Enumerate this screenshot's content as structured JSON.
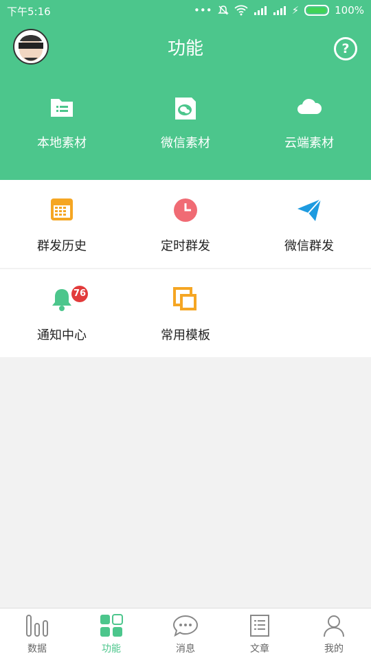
{
  "status_bar": {
    "time": "下午5:16",
    "battery": "100%",
    "icons": [
      "more-icon",
      "mute-bell-icon",
      "wifi-icon",
      "signal-icon",
      "signal-icon",
      "charging-icon",
      "battery-icon"
    ]
  },
  "header": {
    "title": "功能",
    "help_glyph": "?",
    "items": [
      {
        "label": "本地素材",
        "icon": "folder-icon"
      },
      {
        "label": "微信素材",
        "icon": "wechat-doc-icon"
      },
      {
        "label": "云端素材",
        "icon": "cloud-icon"
      }
    ]
  },
  "grid_row1": [
    {
      "label": "群发历史",
      "icon": "calendar-icon"
    },
    {
      "label": "定时群发",
      "icon": "clock-icon"
    },
    {
      "label": "微信群发",
      "icon": "paper-plane-icon"
    }
  ],
  "grid_row2": [
    {
      "label": "通知中心",
      "icon": "bell-icon",
      "badge": "76"
    },
    {
      "label": "常用模板",
      "icon": "copy-icon"
    }
  ],
  "tabbar": {
    "items": [
      {
        "label": "数据",
        "icon": "bar-chart-icon"
      },
      {
        "label": "功能",
        "icon": "grid-icon"
      },
      {
        "label": "消息",
        "icon": "chat-icon"
      },
      {
        "label": "文章",
        "icon": "document-icon"
      },
      {
        "label": "我的",
        "icon": "user-icon"
      }
    ],
    "active_index": 1
  },
  "colors": {
    "brand": "#4cc68c",
    "badge": "#e23b3b",
    "calendar": "#f5a623",
    "clock": "#f06b74",
    "plane": "#1e9be0"
  }
}
